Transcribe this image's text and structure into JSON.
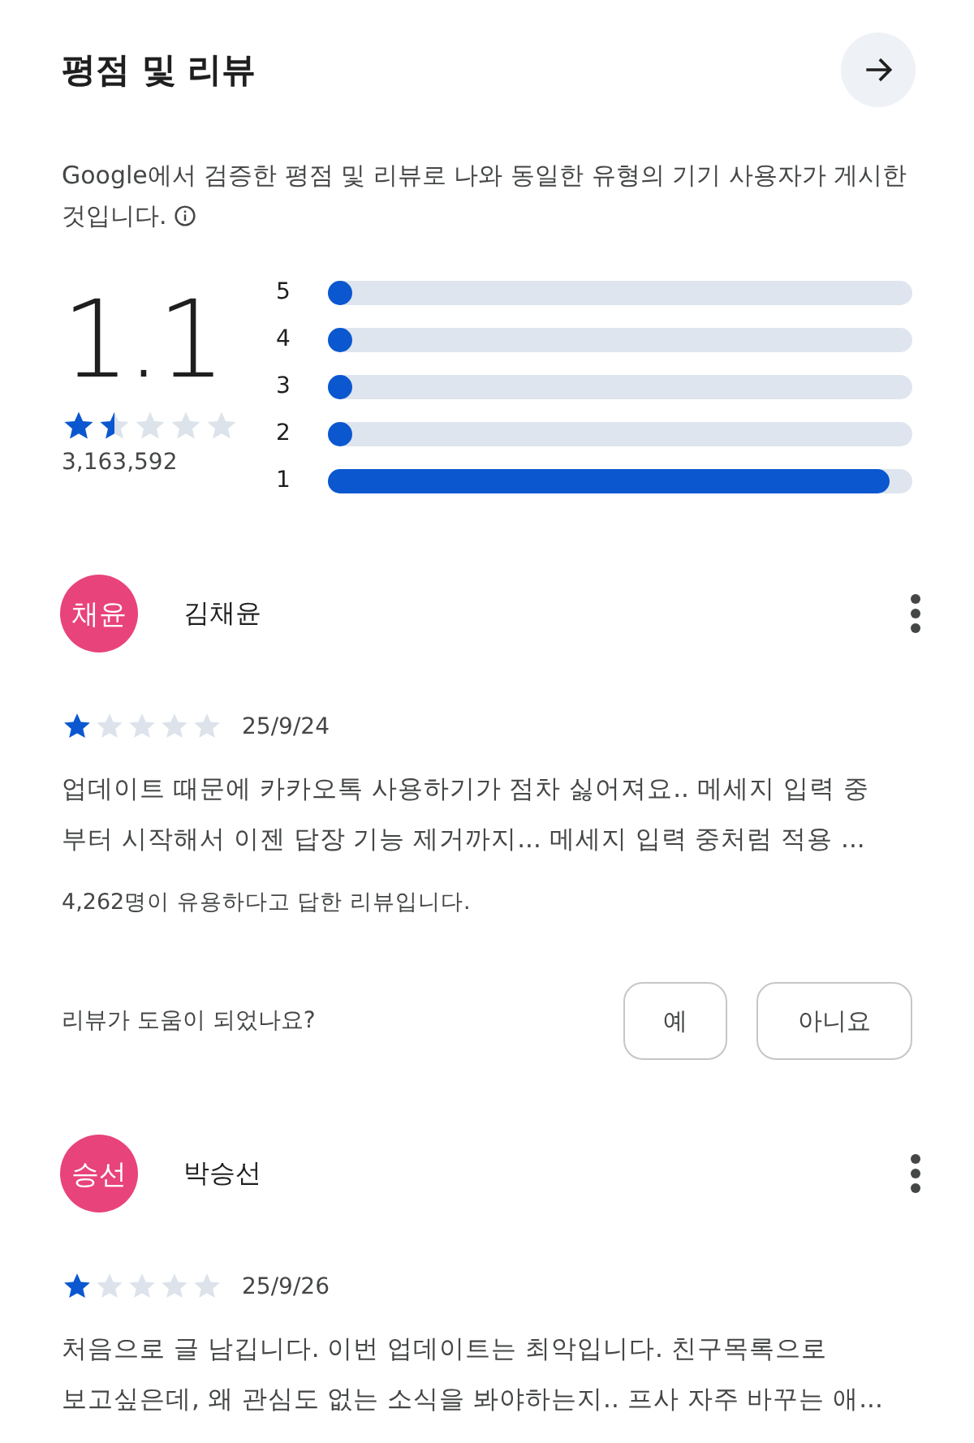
{
  "header": {
    "title": "평점 및 리뷰"
  },
  "description_lines": [
    "Google에서 검증한 평점 및 리뷰로 나와 동일한 유형의 기기 사용자가 게시한",
    "것입니다."
  ],
  "summary": {
    "rating": "1.1",
    "stars": 1.5,
    "count": "3,163,592"
  },
  "distribution": [
    {
      "label": "5",
      "level": 0.02
    },
    {
      "label": "4",
      "level": 0.02
    },
    {
      "label": "3",
      "level": 0.02
    },
    {
      "label": "2",
      "level": 0.02
    },
    {
      "label": "1",
      "level": 0.96
    }
  ],
  "reviews": [
    {
      "avatar": "채윤",
      "color": "#e8437b",
      "name": "김채윤",
      "stars": 1,
      "date": "25/9/24",
      "text_lines": [
        "업데이트 때문에 카카오톡 사용하기가 점차 싫어져요.. 메세지 입력 중",
        "부터 시작해서 이젠 답장 기능 제거까지... 메세지 입력 중처럼 적용 ..."
      ],
      "helpful": "4,262명이 유용하다고 답한 리뷰입니다.",
      "question": "리뷰가 도움이 되었나요?",
      "buttons": [
        "예",
        "아니요"
      ]
    },
    {
      "avatar": "승선",
      "color": "#e8437b",
      "name": "박승선",
      "stars": 1,
      "date": "25/9/26",
      "text_lines": [
        "처음으로 글 남깁니다. 이번 업데이트는 최악입니다. 친구목록으로",
        "보고싶은데, 왜 관심도 없는 소식을 봐야하는지.. 프사 자주 바꾸는 애..."
      ]
    }
  ]
}
